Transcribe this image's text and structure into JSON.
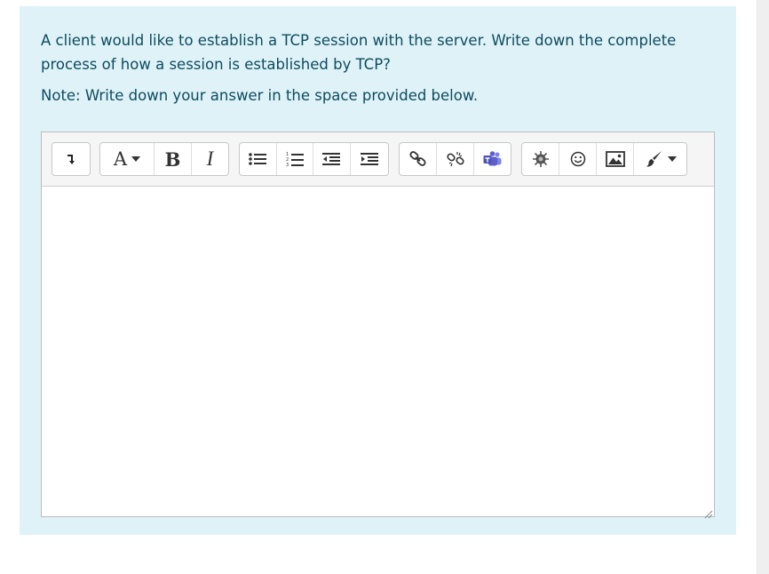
{
  "question": {
    "text": "A client would like to establish a TCP session with the server. Write down the complete process of how a session is established by TCP?",
    "note": "Note: Write down your answer in the space provided below."
  },
  "editor": {
    "answer_value": "",
    "toolbar": {
      "font_label": "A",
      "bold_label": "B",
      "italic_label": "I"
    }
  },
  "icons": [
    "toolbar-toggle-icon",
    "font-style-icon",
    "bold-icon",
    "italic-icon",
    "unordered-list-icon",
    "ordered-list-icon",
    "outdent-icon",
    "indent-icon",
    "link-icon",
    "unlink-icon",
    "teams-icon",
    "equation-icon",
    "emoji-icon",
    "image-icon",
    "paint-brush-icon"
  ],
  "colors": {
    "question_background": "#def2f8",
    "question_text": "#0f4c5c",
    "toolbar_background": "#f5f5f5",
    "teams_purple": "#5b5fc7"
  }
}
